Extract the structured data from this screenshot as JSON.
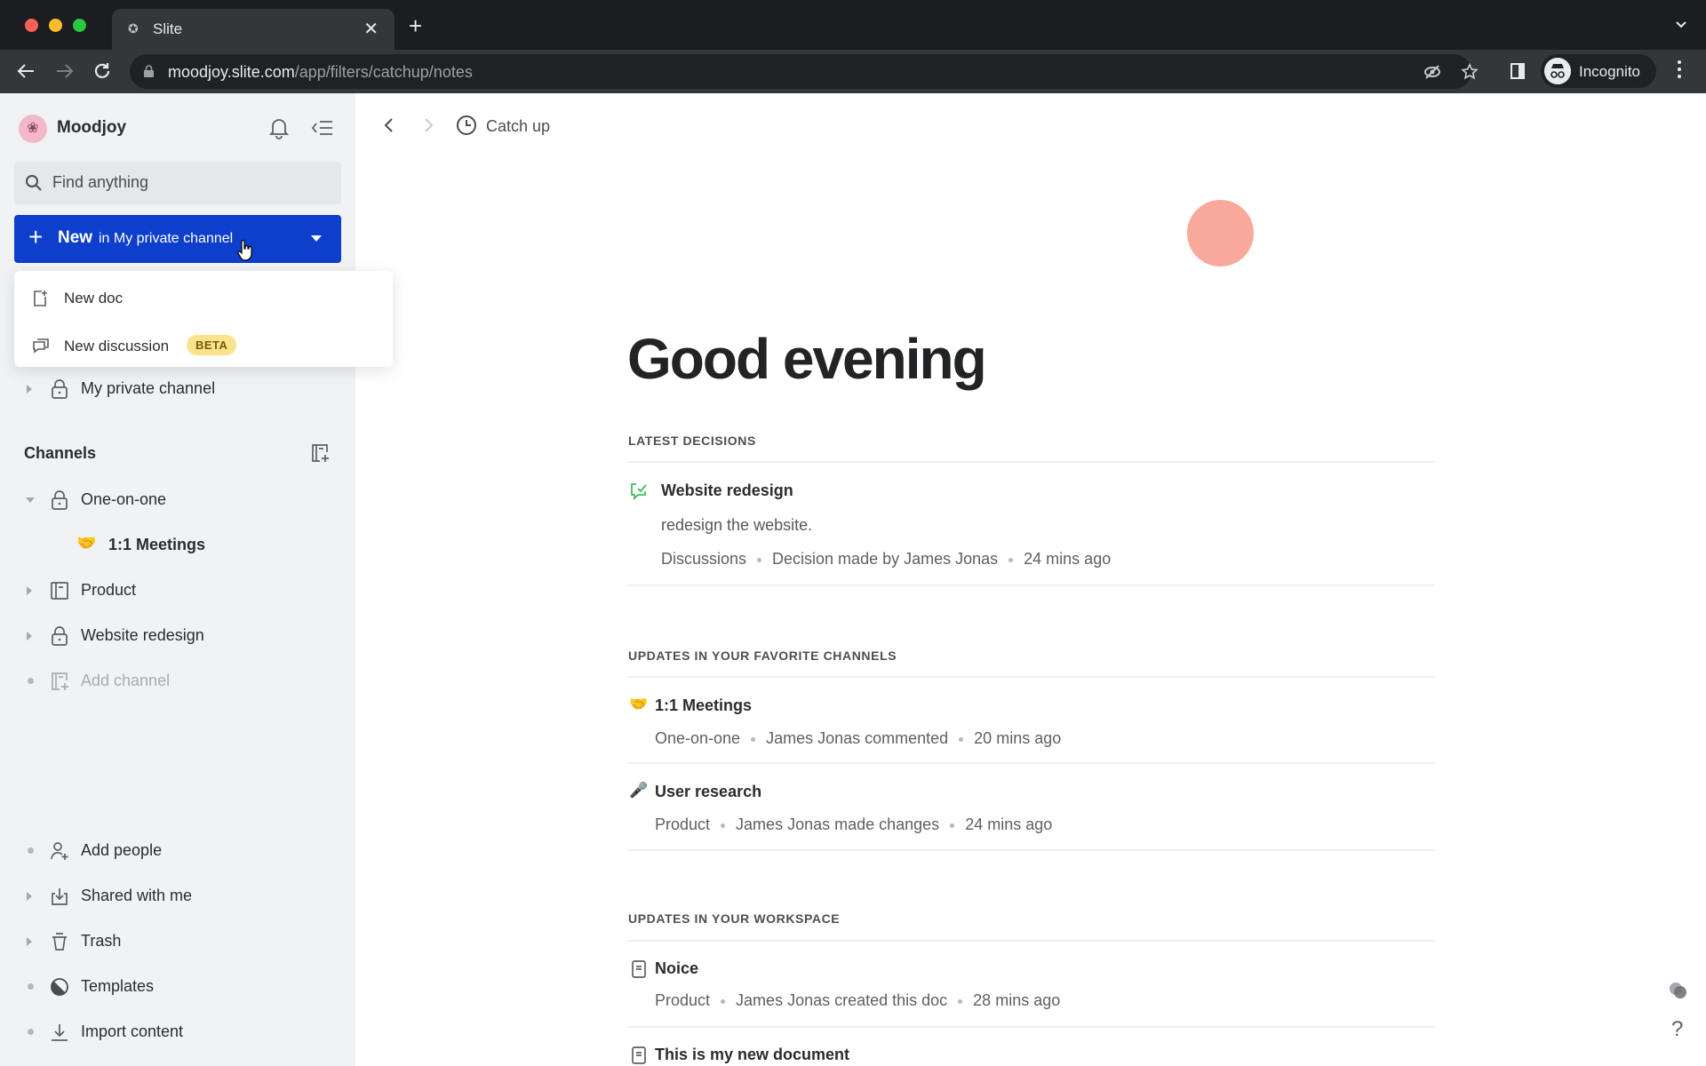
{
  "browser": {
    "tab_title": "Slite",
    "url_host": "moodjoy.slite.com",
    "url_path": "/app/filters/catchup/notes",
    "profile_label": "Incognito",
    "traffic_colors": [
      "#fe5f57",
      "#febc2e",
      "#28c840"
    ]
  },
  "sidebar": {
    "workspace_name": "Moodjoy",
    "search_placeholder": "Find anything",
    "new_button": {
      "bold": "New",
      "context": "in My private channel"
    },
    "new_menu": [
      {
        "label": "New doc",
        "icon": "new-doc-icon"
      },
      {
        "label": "New discussion",
        "icon": "discussion-icon",
        "badge": "BETA"
      }
    ],
    "private_channel": {
      "label": "My private channel",
      "icon": "lock-icon"
    },
    "channels_heading": "Channels",
    "channels": [
      {
        "label": "One-on-one",
        "icon": "lock-icon",
        "expanded": true
      },
      {
        "label": "1:1 Meetings",
        "icon": "handshake-emoji",
        "child": true
      },
      {
        "label": "Product",
        "icon": "channel-icon"
      },
      {
        "label": "Website redesign",
        "icon": "lock-icon"
      },
      {
        "label": "Add channel",
        "icon": "add-channel-icon",
        "muted": true
      }
    ],
    "footer": [
      {
        "label": "Add people",
        "icon": "add-person-icon"
      },
      {
        "label": "Shared with me",
        "icon": "inbox-download-icon"
      },
      {
        "label": "Trash",
        "icon": "trash-icon"
      },
      {
        "label": "Templates",
        "icon": "templates-icon"
      },
      {
        "label": "Import content",
        "icon": "import-icon"
      }
    ]
  },
  "main": {
    "breadcrumb": "Catch up",
    "greeting": "Good evening",
    "accent_blob_color": "#f9a99b",
    "sections": [
      {
        "heading": "LATEST DECISIONS",
        "items": [
          {
            "title": "Website redesign",
            "subtitle": "redesign the website.",
            "meta": [
              "Discussions",
              "Decision made by James Jonas",
              "24 mins ago"
            ],
            "icon": "decision-icon"
          }
        ]
      },
      {
        "heading": "UPDATES IN YOUR FAVORITE CHANNELS",
        "items": [
          {
            "title": "1:1 Meetings",
            "meta": [
              "One-on-one",
              "James Jonas commented",
              "20 mins ago"
            ],
            "icon": "handshake-emoji"
          },
          {
            "title": "User research",
            "meta": [
              "Product",
              "James Jonas made changes",
              "24 mins ago"
            ],
            "icon": "microphone-emoji"
          }
        ]
      },
      {
        "heading": "UPDATES IN YOUR WORKSPACE",
        "items": [
          {
            "title": "Noice",
            "meta": [
              "Product",
              "James Jonas created this doc",
              "28 mins ago"
            ],
            "icon": "doc-icon"
          },
          {
            "title": "This is my new document",
            "icon": "doc-icon"
          }
        ]
      }
    ],
    "help_label": "?"
  }
}
